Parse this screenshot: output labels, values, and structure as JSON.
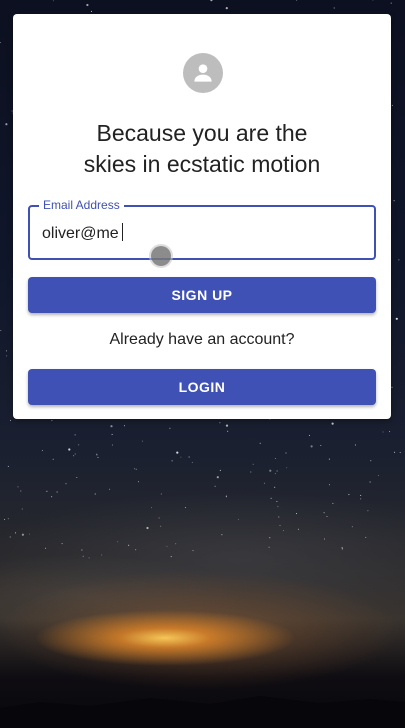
{
  "card": {
    "title_line1": "Because you are the",
    "title_line2": "skies in ecstatic motion",
    "avatar_icon": "person-icon"
  },
  "form": {
    "email_label": "Email Address",
    "email_value": "oliver@me"
  },
  "buttons": {
    "signup_label": "SIGN UP",
    "login_label": "LOGIN"
  },
  "account_prompt": "Already have an account?",
  "colors": {
    "primary": "#3f51b5",
    "card": "#ffffff",
    "avatar_bg": "#bdbdbd"
  }
}
